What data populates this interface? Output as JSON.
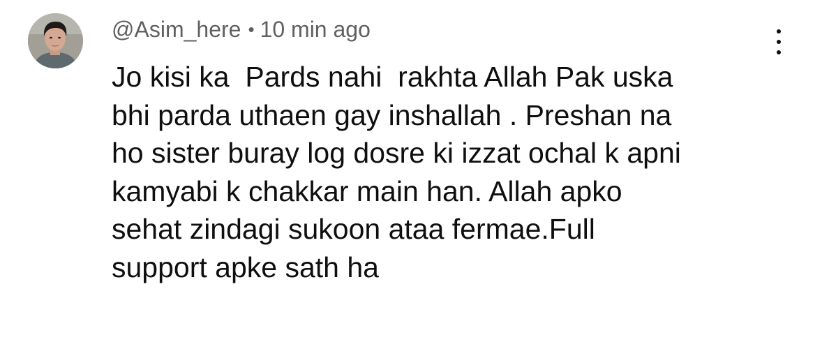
{
  "comment": {
    "author": "@Asim_here",
    "separator": "•",
    "timestamp": "10 min ago",
    "text": "Jo kisi ka  Pards nahi  rakhta Allah Pak uska\nbhi parda uthaen gay inshallah . Preshan na\nho sister buray log dosre ki izzat ochal k apni\nkamyabi k chakkar main han. Allah apko\nsehat zindagi sukoon ataa fermae.Full\nsupport apke sath ha",
    "avatar_icon": "user-avatar-photo",
    "menu_icon": "more-vertical-icon"
  },
  "colors": {
    "meta_text": "#606060",
    "body_text": "#0f0f0f",
    "background": "#ffffff"
  }
}
